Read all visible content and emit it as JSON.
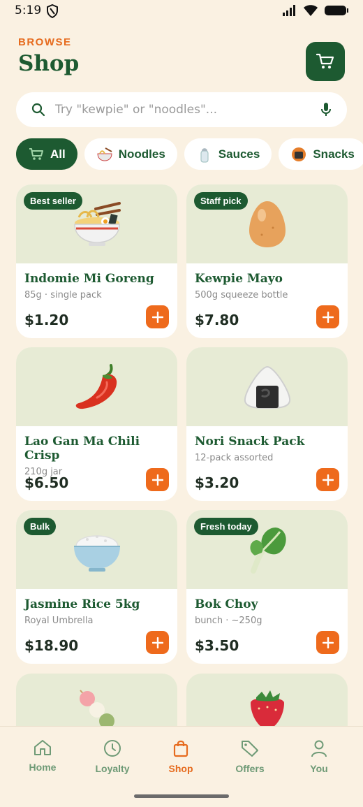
{
  "status": {
    "time": "5:19"
  },
  "header": {
    "eyebrow": "BROWSE",
    "title": "Shop"
  },
  "search": {
    "placeholder": "Try \"kewpie\" or \"noodles\"..."
  },
  "chips": [
    {
      "label": "All",
      "icon": "cart-icon",
      "active": true
    },
    {
      "label": "Noodles",
      "icon": "ramen-icon"
    },
    {
      "label": "Sauces",
      "icon": "salt-shaker-icon"
    },
    {
      "label": "Snacks",
      "icon": "onigiri-icon"
    }
  ],
  "products": [
    {
      "badge": "Best seller",
      "name": "Indomie Mi Goreng",
      "meta": "85g · single pack",
      "price": "$1.20",
      "icon": "ramen-bowl-icon"
    },
    {
      "badge": "Staff pick",
      "name": "Kewpie Mayo",
      "meta": "500g squeeze bottle",
      "price": "$7.80",
      "icon": "egg-icon"
    },
    {
      "badge": "",
      "name": "Lao Gan Ma Chili Crisp",
      "meta": "210g jar",
      "price": "$6.50",
      "icon": "chili-pepper-icon"
    },
    {
      "badge": "",
      "name": "Nori Snack Pack",
      "meta": "12-pack assorted",
      "price": "$3.20",
      "icon": "onigiri-icon"
    },
    {
      "badge": "Bulk",
      "name": "Jasmine Rice 5kg",
      "meta": "Royal Umbrella",
      "price": "$18.90",
      "icon": "rice-bowl-icon"
    },
    {
      "badge": "Fresh today",
      "name": "Bok Choy",
      "meta": "bunch · ~250g",
      "price": "$3.50",
      "icon": "leafy-green-icon"
    }
  ],
  "partial_products": [
    {
      "icon": "dango-icon"
    },
    {
      "icon": "strawberry-icon"
    }
  ],
  "nav": {
    "items": [
      {
        "label": "Home",
        "icon": "home-icon"
      },
      {
        "label": "Loyalty",
        "icon": "clock-icon"
      },
      {
        "label": "Shop",
        "icon": "shopping-bag-icon",
        "active": true
      },
      {
        "label": "Offers",
        "icon": "tag-icon"
      },
      {
        "label": "You",
        "icon": "person-icon"
      }
    ]
  },
  "colors": {
    "brand_green": "#1d5a31",
    "accent_orange": "#ee6a1c",
    "background": "#faf1e2",
    "card_top": "#e7ebd5"
  }
}
